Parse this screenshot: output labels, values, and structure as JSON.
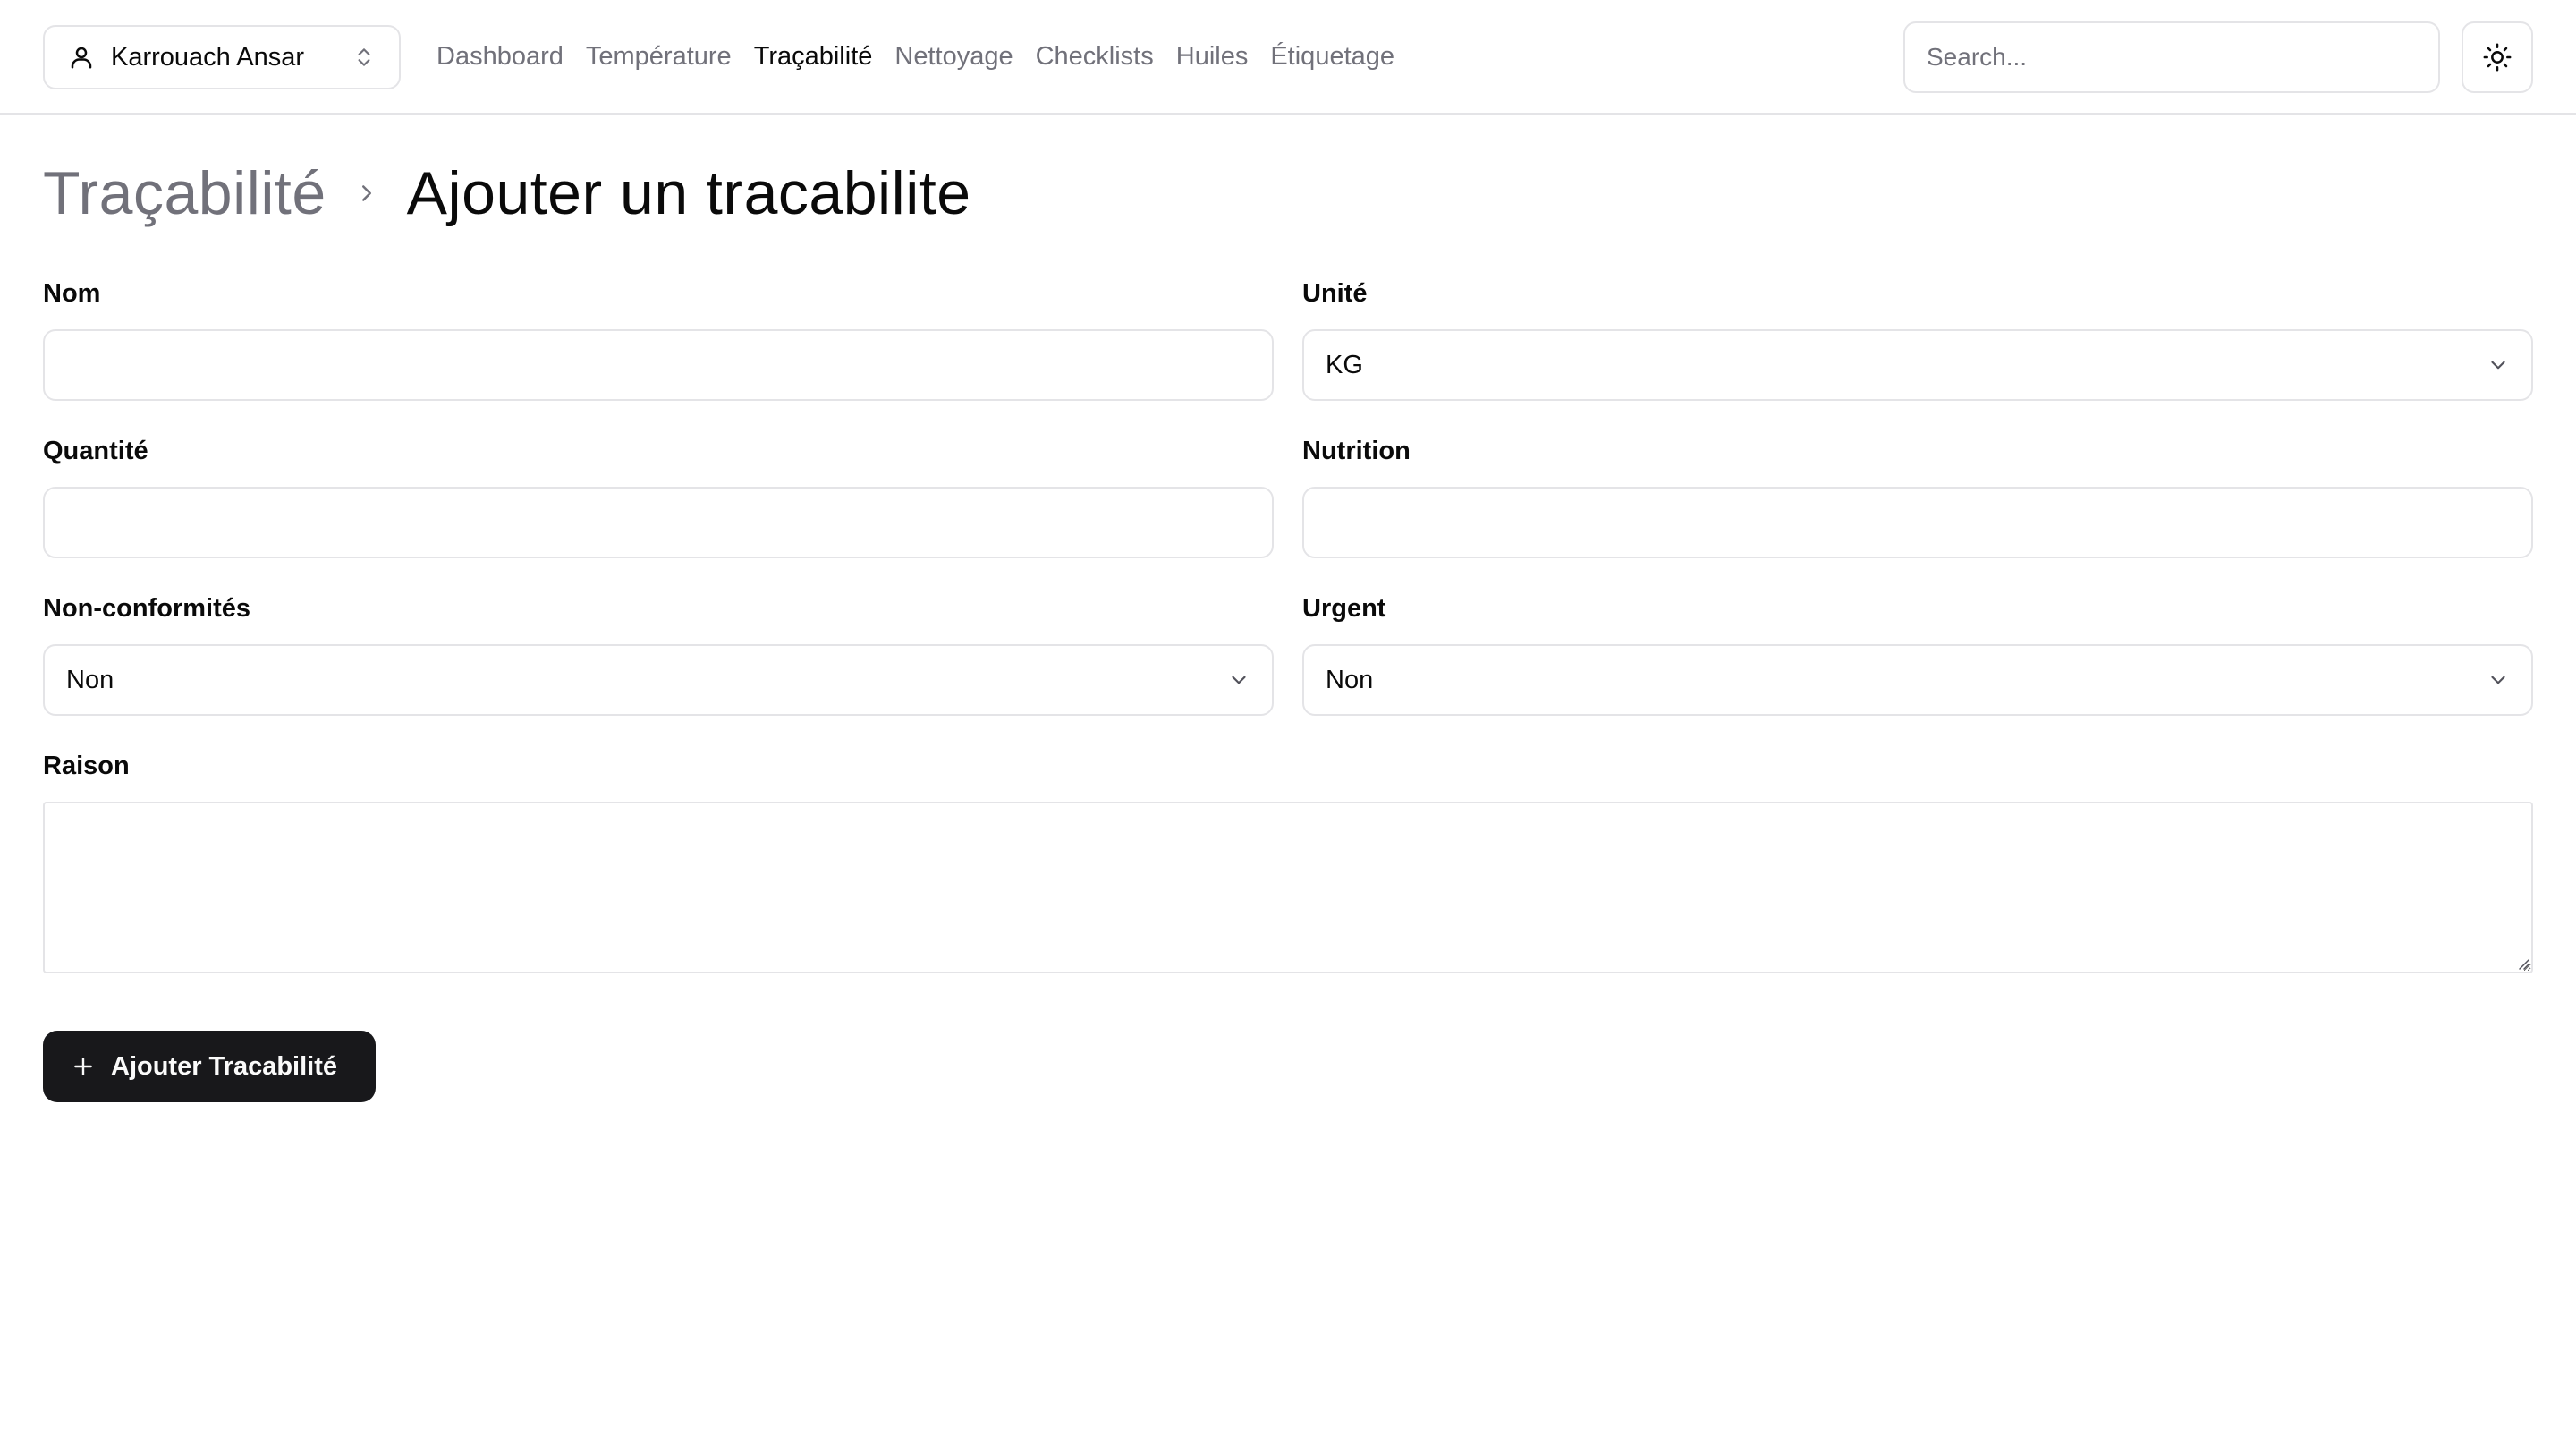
{
  "user_switcher": {
    "name": "Karrouach Ansar"
  },
  "nav": {
    "items": [
      {
        "label": "Dashboard",
        "active": false
      },
      {
        "label": "Température",
        "active": false
      },
      {
        "label": "Traçabilité",
        "active": true
      },
      {
        "label": "Nettoyage",
        "active": false
      },
      {
        "label": "Checklists",
        "active": false
      },
      {
        "label": "Huiles",
        "active": false
      },
      {
        "label": "Étiquetage",
        "active": false
      }
    ]
  },
  "search": {
    "placeholder": "Search..."
  },
  "theme_toggle": {
    "icon": "sun-icon"
  },
  "breadcrumb": {
    "parent": "Traçabilité",
    "current": "Ajouter un tracabilite"
  },
  "form": {
    "nom": {
      "label": "Nom",
      "value": ""
    },
    "unite": {
      "label": "Unité",
      "value": "KG"
    },
    "quantite": {
      "label": "Quantité",
      "value": ""
    },
    "nutrition": {
      "label": "Nutrition",
      "value": ""
    },
    "non_conformites": {
      "label": "Non-conformités",
      "value": "Non"
    },
    "urgent": {
      "label": "Urgent",
      "value": "Non"
    },
    "raison": {
      "label": "Raison",
      "value": ""
    },
    "submit_label": "Ajouter Tracabilité"
  },
  "colors": {
    "primary": "#18181b",
    "muted_text": "#71717a",
    "border": "#e4e4e7",
    "background": "#ffffff"
  }
}
